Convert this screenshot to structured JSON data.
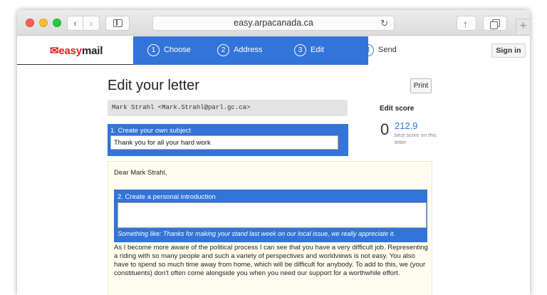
{
  "browser": {
    "url": "easy.arpacanada.ca",
    "back_glyph": "‹",
    "forward_glyph": "›",
    "reload_glyph": "↻",
    "share_glyph": "↑",
    "newtab_glyph": "+"
  },
  "header": {
    "logo_icon": "✉",
    "logo_prefix": "easy",
    "logo_suffix": "mail",
    "sign_in": "Sign in",
    "steps": [
      {
        "num": "1",
        "label": "Choose"
      },
      {
        "num": "2",
        "label": "Address"
      },
      {
        "num": "3",
        "label": "Edit"
      },
      {
        "num": "4",
        "label": "Send"
      }
    ]
  },
  "main": {
    "title": "Edit your letter",
    "print_label": "Print",
    "recipient": "Mark Strahl <Mark.Strahl@parl.gc.ca>",
    "subject_label": "1. Create your own subject",
    "subject_value": "Thank you for all your hard work",
    "edit_score_label": "Edit score",
    "edit_score_value": "0",
    "best_score": "212.9",
    "best_score_note": "best score on this letter",
    "letter_greeting": "Dear Mark Strahl,",
    "intro_label": "2. Create a personal introduction",
    "intro_value": "",
    "intro_hint": "Something like: Thanks for making your stand last week on our local issue, we really appreciate it.",
    "letter_body": "As I become more aware of the political process I can see that you have a very difficult job. Representing a riding with so many people and such a variety of perspectives and worldviews is not easy. You also have to spend so much time away from home, which will be difficult for anybody. To add to this, we (your constituents) don't often come alongside you when you need our support for a worthwhile effort."
  }
}
